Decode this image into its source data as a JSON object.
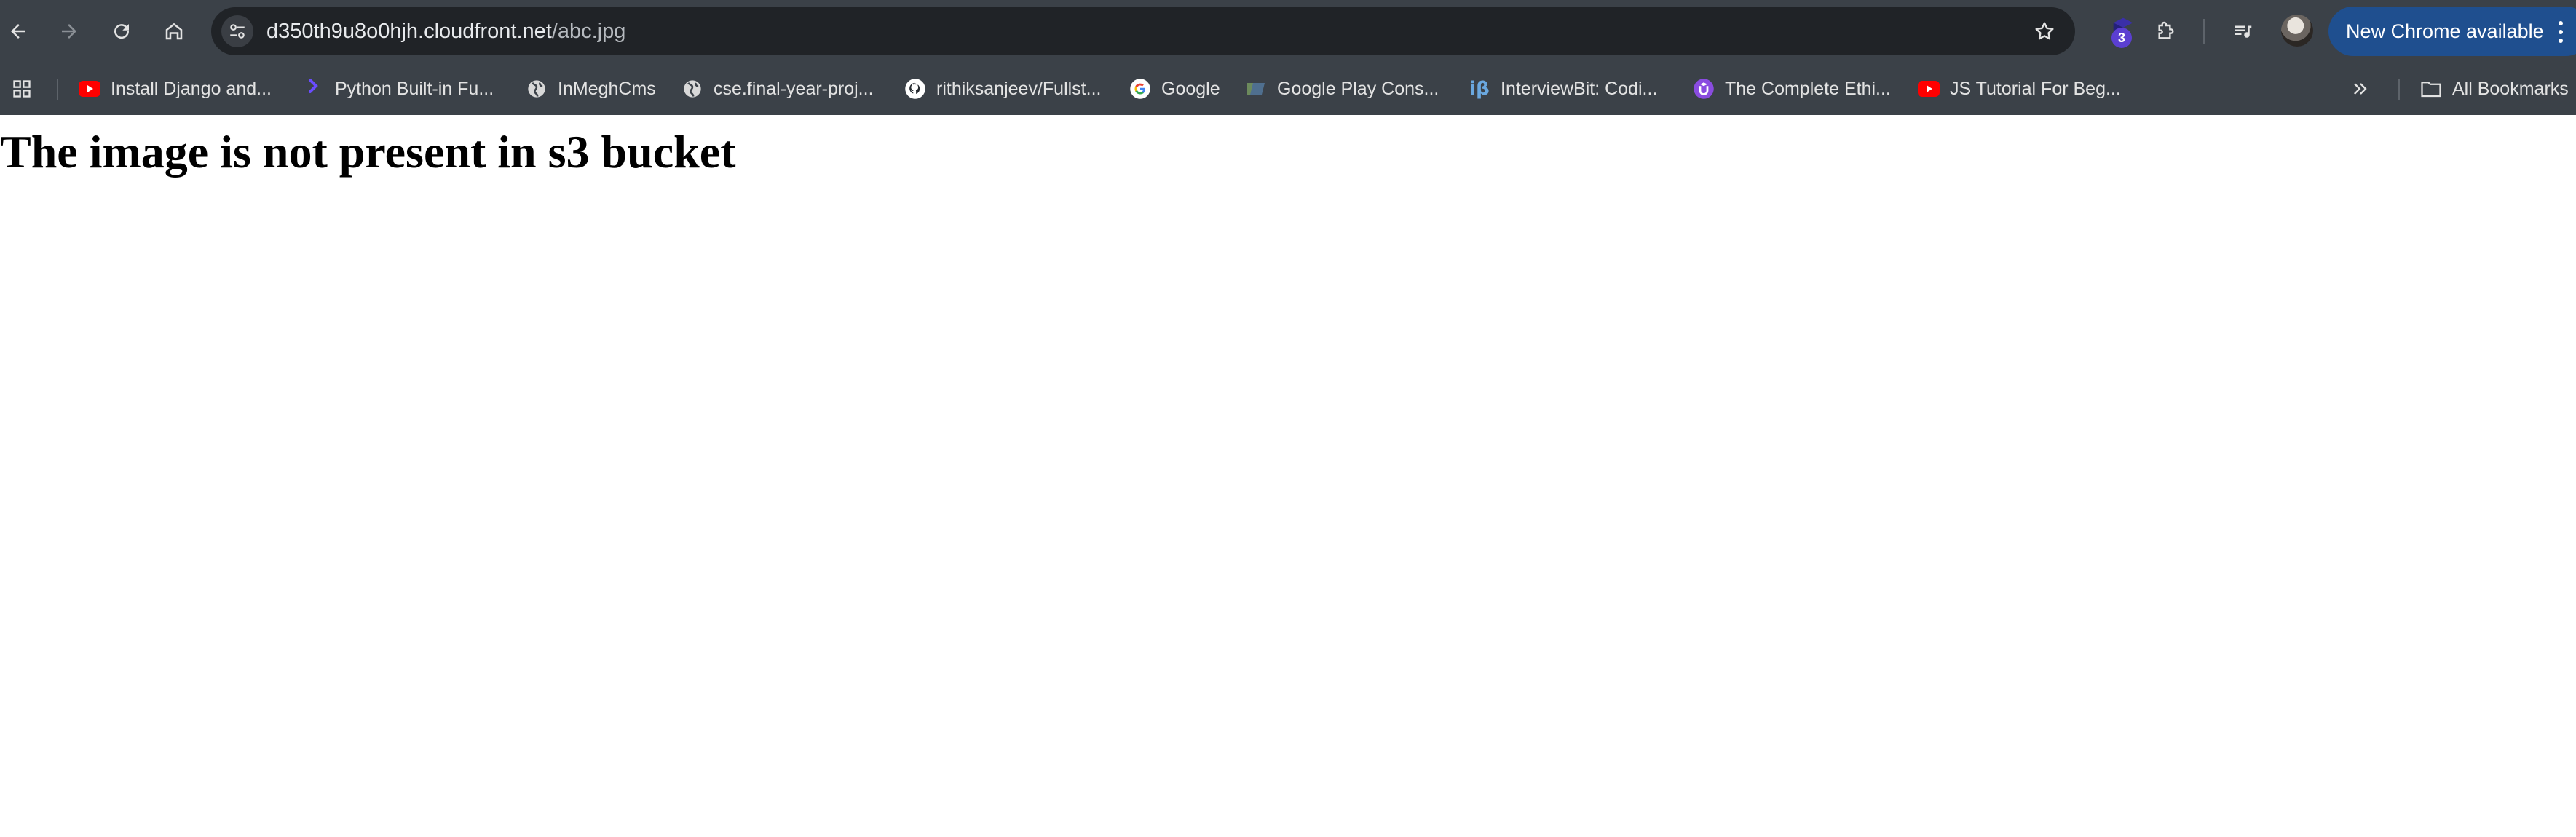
{
  "browser": {
    "omnibox": {
      "host": "d350th9u8o0hjh.cloudfront.net",
      "path": "/abc.jpg"
    },
    "extension_badge_count": "3",
    "update_button_label": "New Chrome available"
  },
  "bookmarks": {
    "items": [
      {
        "label": "Install Django and...",
        "icon": "youtube-icon"
      },
      {
        "label": "Python Built-in Fu...",
        "icon": "python-icon"
      },
      {
        "label": "InMeghCms",
        "icon": "globe-icon"
      },
      {
        "label": "cse.final-year-proj...",
        "icon": "globe-icon"
      },
      {
        "label": "rithiksanjeev/Fullst...",
        "icon": "github-icon"
      },
      {
        "label": "Google",
        "icon": "google-icon"
      },
      {
        "label": "Google Play Cons...",
        "icon": "google-play-console-icon"
      },
      {
        "label": "InterviewBit: Codi...",
        "icon": "interviewbit-icon"
      },
      {
        "label": "The Complete Ethi...",
        "icon": "udemy-icon"
      },
      {
        "label": "JS Tutorial For Beg...",
        "icon": "youtube-icon"
      }
    ],
    "all_bookmarks_label": "All Bookmarks"
  },
  "page": {
    "heading": "The image is not present in s3 bucket"
  },
  "colors": {
    "toolbar_bg": "#3b4148",
    "omnibox_bg": "#202327",
    "update_button_bg": "#1f4f8f",
    "badge_bg": "#5b3fd1",
    "youtube_red": "#ff0000"
  }
}
